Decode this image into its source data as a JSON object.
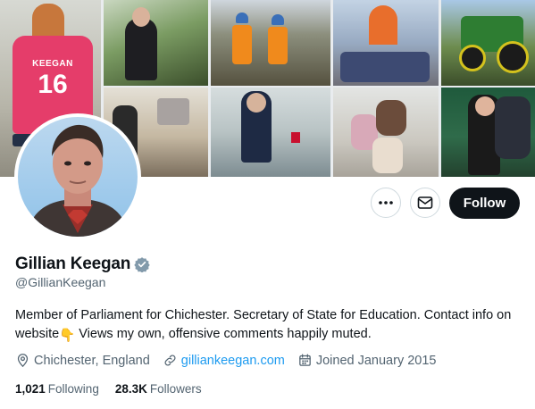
{
  "profile": {
    "display_name": "Gillian Keegan",
    "handle": "@GillianKeegan",
    "bio_part1": "Member of Parliament for Chichester. Secretary of State for Education. Contact info on website",
    "bio_emoji": "👇",
    "bio_part2": " Views my own, offensive comments happily muted.",
    "location": "Chichester, England",
    "website": "gilliankeegan.com",
    "joined": "Joined January 2015",
    "following_count": "1,021",
    "following_label": "Following",
    "followers_count": "28.3K",
    "followers_label": "Followers"
  },
  "actions": {
    "follow_label": "Follow"
  },
  "banner": {
    "shirt_name": "KEEGAN",
    "shirt_number": "16"
  },
  "colors": {
    "accent": "#1d9bf0",
    "follow_button": "#0f1419",
    "secondary_text": "#536471",
    "verified_badge": "#829aab"
  }
}
